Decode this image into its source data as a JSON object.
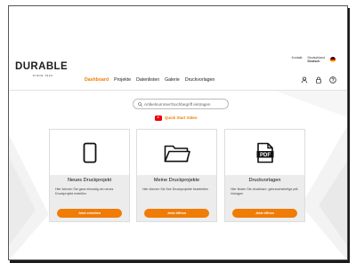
{
  "brand": {
    "name": "DURABLE",
    "tagline": "SINCE 1920"
  },
  "top_links": {
    "contact": "Kontakt",
    "country": "Deutschland",
    "language": "Deutsch"
  },
  "nav": {
    "items": [
      {
        "label": "Dashboard",
        "active": true
      },
      {
        "label": "Projekte",
        "active": false
      },
      {
        "label": "Datenlisten",
        "active": false
      },
      {
        "label": "Galerie",
        "active": false
      },
      {
        "label": "Druckvorlagen",
        "active": false
      }
    ]
  },
  "header_icons": [
    "user-icon",
    "lock-icon",
    "help-icon"
  ],
  "search": {
    "placeholder": "Artikelnummer/Suchbegriff eintragen"
  },
  "quick_start": {
    "label": "Quick Start Video"
  },
  "cards": [
    {
      "icon": "blank-page-icon",
      "title": "Neues Druckprojekt",
      "description": "Hier können Sie ganz einmalig ein neues Druckprojekt erstellen",
      "button": "Jetzt erstellen"
    },
    {
      "icon": "folder-icon",
      "title": "Meine Druckprojekte",
      "description": "Hier können Sie Ihre Druckprojekte bearbeiten",
      "button": "Jetzt öffnen"
    },
    {
      "icon": "pdf-file-icon",
      "title": "Druckvorlagen",
      "description": "Hier finden Sie druckbare, gebrauchsfertige pdf-Vorlagen",
      "button": "Jetzt öffnen"
    }
  ],
  "colors": {
    "accent": "#f07b05",
    "card_lower": "#ececec"
  }
}
